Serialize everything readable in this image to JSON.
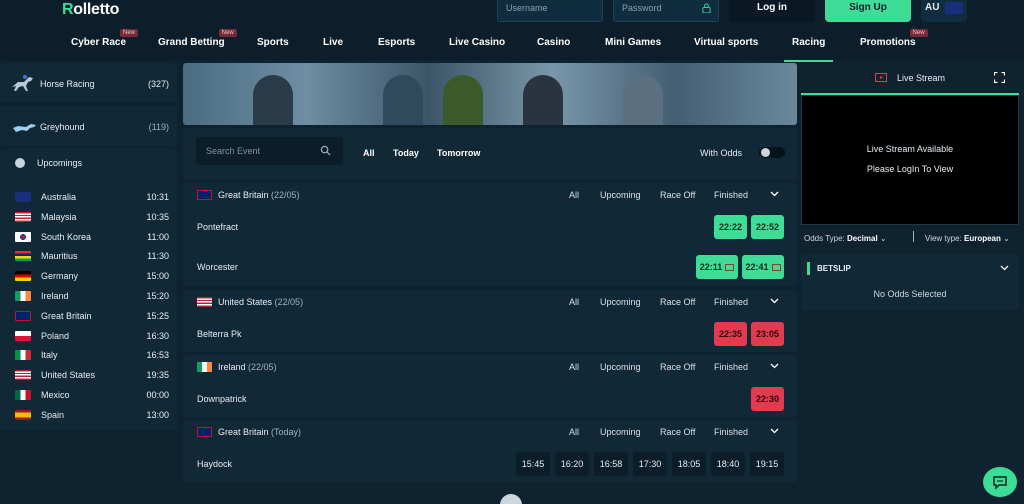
{
  "header": {
    "logo_text": "Rolletto",
    "username_placeholder": "Username",
    "password_placeholder": "Password",
    "login_label": "Log in",
    "signup_label": "Sign Up",
    "lang": "AU"
  },
  "nav": {
    "items": [
      {
        "label": "Cyber Race",
        "badge": "New"
      },
      {
        "label": "Grand Betting",
        "badge": "New"
      },
      {
        "label": "Sports"
      },
      {
        "label": "Live"
      },
      {
        "label": "Esports"
      },
      {
        "label": "Live Casino"
      },
      {
        "label": "Casino"
      },
      {
        "label": "Mini Games"
      },
      {
        "label": "Virtual sports"
      },
      {
        "label": "Racing"
      },
      {
        "label": "Promotions",
        "badge": "New"
      }
    ],
    "active": "Racing"
  },
  "sidebar": {
    "horse_racing": {
      "label": "Horse Racing",
      "count": "(327)"
    },
    "greyhound": {
      "label": "Greyhound",
      "count": "(119)"
    },
    "upcomings_label": "Upcomings",
    "countries": [
      {
        "name": "Australia",
        "time": "10:31"
      },
      {
        "name": "Malaysia",
        "time": "10:35"
      },
      {
        "name": "South Korea",
        "time": "11:00"
      },
      {
        "name": "Mauritius",
        "time": "11:30"
      },
      {
        "name": "Germany",
        "time": "15:00"
      },
      {
        "name": "Ireland",
        "time": "15:20"
      },
      {
        "name": "Great Britain",
        "time": "15:25"
      },
      {
        "name": "Poland",
        "time": "16:30"
      },
      {
        "name": "Italy",
        "time": "16:53"
      },
      {
        "name": "United States",
        "time": "19:35"
      },
      {
        "name": "Mexico",
        "time": "00:00"
      },
      {
        "name": "Spain",
        "time": "13:00"
      }
    ]
  },
  "filters": {
    "search_placeholder": "Search Event",
    "tabs": [
      "All",
      "Today",
      "Tomorrow"
    ],
    "with_odds_label": "With Odds"
  },
  "section_tabs": [
    "All",
    "Upcoming",
    "Race Off",
    "Finished"
  ],
  "sections": [
    {
      "country": "Great Britain",
      "date": "(22/05)",
      "races": [
        {
          "name": "Pontefract",
          "times": [
            "22:22",
            "22:52"
          ]
        },
        {
          "name": "Worcester",
          "times": [
            "22:11",
            "22:41"
          ]
        }
      ]
    },
    {
      "country": "United States",
      "date": "(22/05)",
      "races": [
        {
          "name": "Belterra Pk",
          "times": [
            "22:35",
            "23:05"
          ]
        }
      ]
    },
    {
      "country": "Ireland",
      "date": "(22/05)",
      "races": [
        {
          "name": "Downpatrick",
          "times": [
            "22:30"
          ]
        }
      ]
    },
    {
      "country": "Great Britain",
      "date": "(Today)",
      "races": [
        {
          "name": "Haydock",
          "times": [
            "15:45",
            "16:20",
            "16:58",
            "17:30",
            "18:05",
            "18:40",
            "19:15"
          ]
        }
      ]
    }
  ],
  "right_panel": {
    "live_stream_label": "Live Stream",
    "stream_line1": "Live Stream Available",
    "stream_line2": "Please LogIn To View",
    "odds_type_label": "Odds Type:",
    "odds_type_value": "Decimal",
    "view_type_label": "View type:",
    "view_type_value": "European",
    "betslip_title": "BETSLIP",
    "betslip_empty": "No Odds Selected"
  },
  "colors": {
    "accent": "#3ddc97",
    "danger": "#e23a4e",
    "bg": "#0e2230",
    "panel": "#112837"
  }
}
